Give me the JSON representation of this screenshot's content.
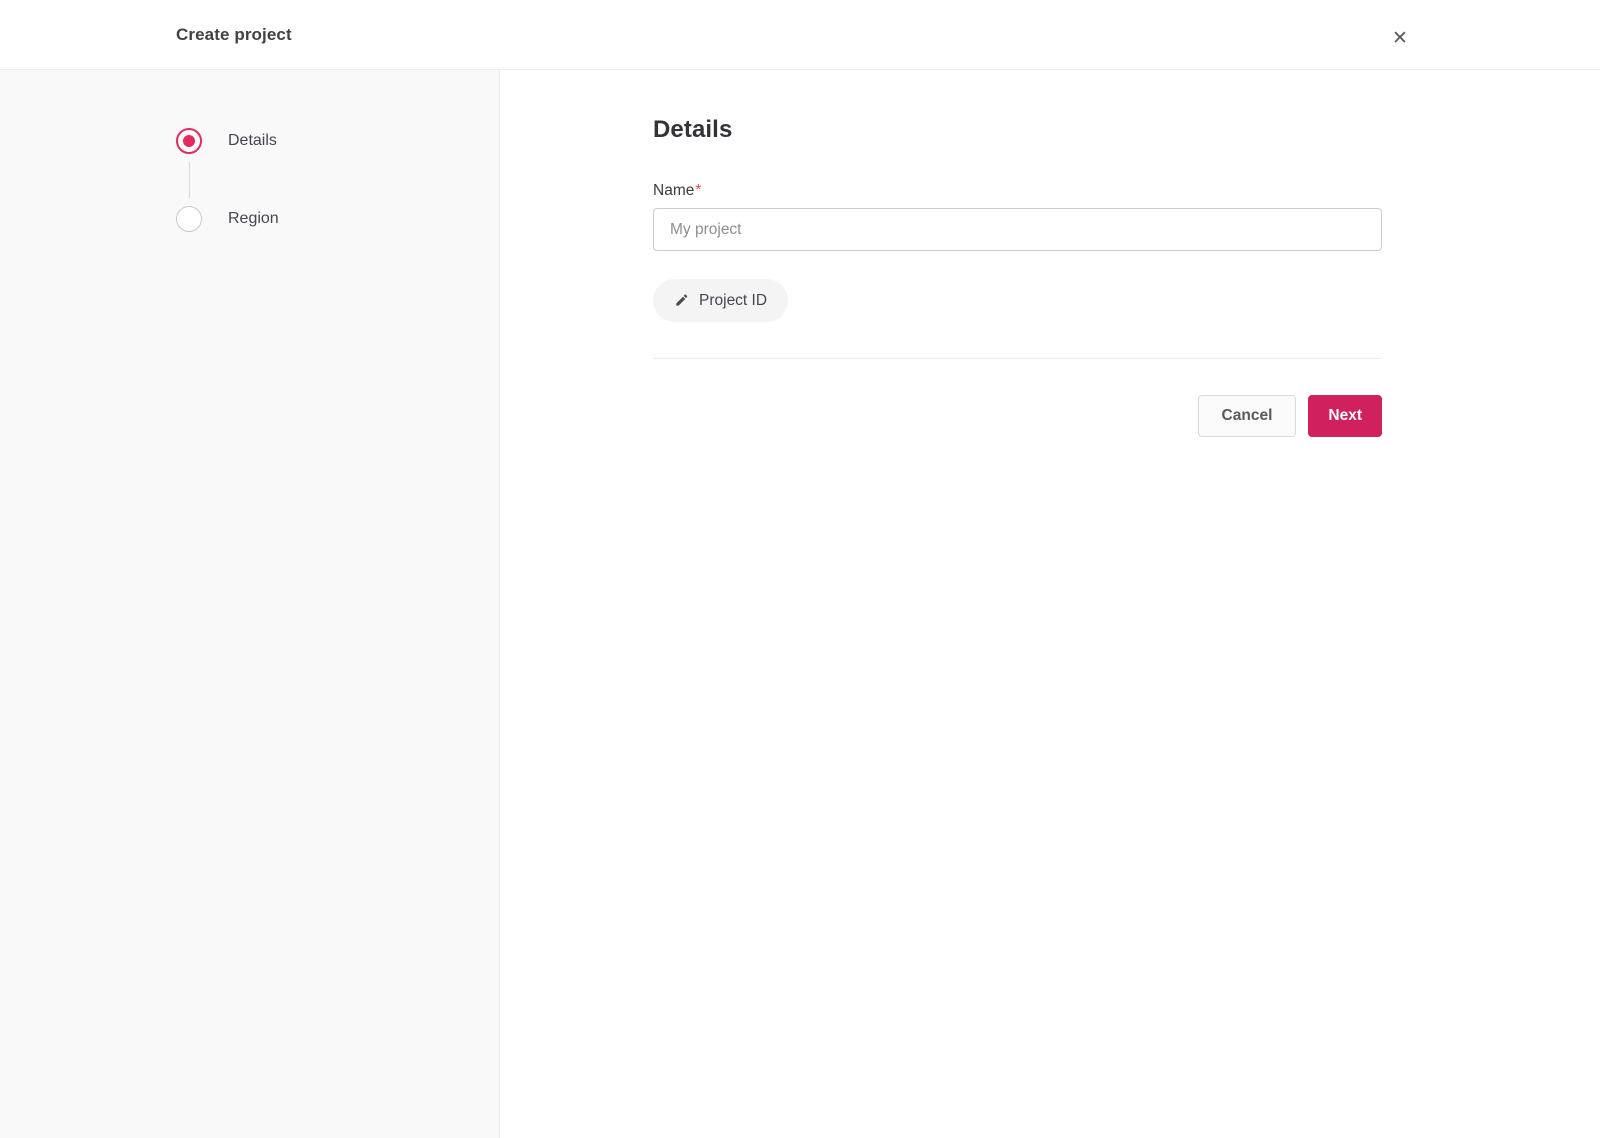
{
  "header": {
    "title": "Create project",
    "close_glyph": "✕"
  },
  "stepper": {
    "steps": [
      {
        "label": "Details",
        "state": "active"
      },
      {
        "label": "Region",
        "state": "inactive"
      }
    ]
  },
  "main": {
    "heading": "Details",
    "form": {
      "name_label": "Name",
      "required_marker": "*",
      "name_value": "",
      "name_placeholder": "My project",
      "project_id_button": "Project ID",
      "project_id_icon": "pencil-icon"
    },
    "actions": {
      "cancel_label": "Cancel",
      "next_label": "Next"
    }
  },
  "colors": {
    "accent": "#d0205e",
    "accent-ring": "#e7295e",
    "required": "#e25050",
    "sidebar-bg": "#f9f9fa"
  }
}
